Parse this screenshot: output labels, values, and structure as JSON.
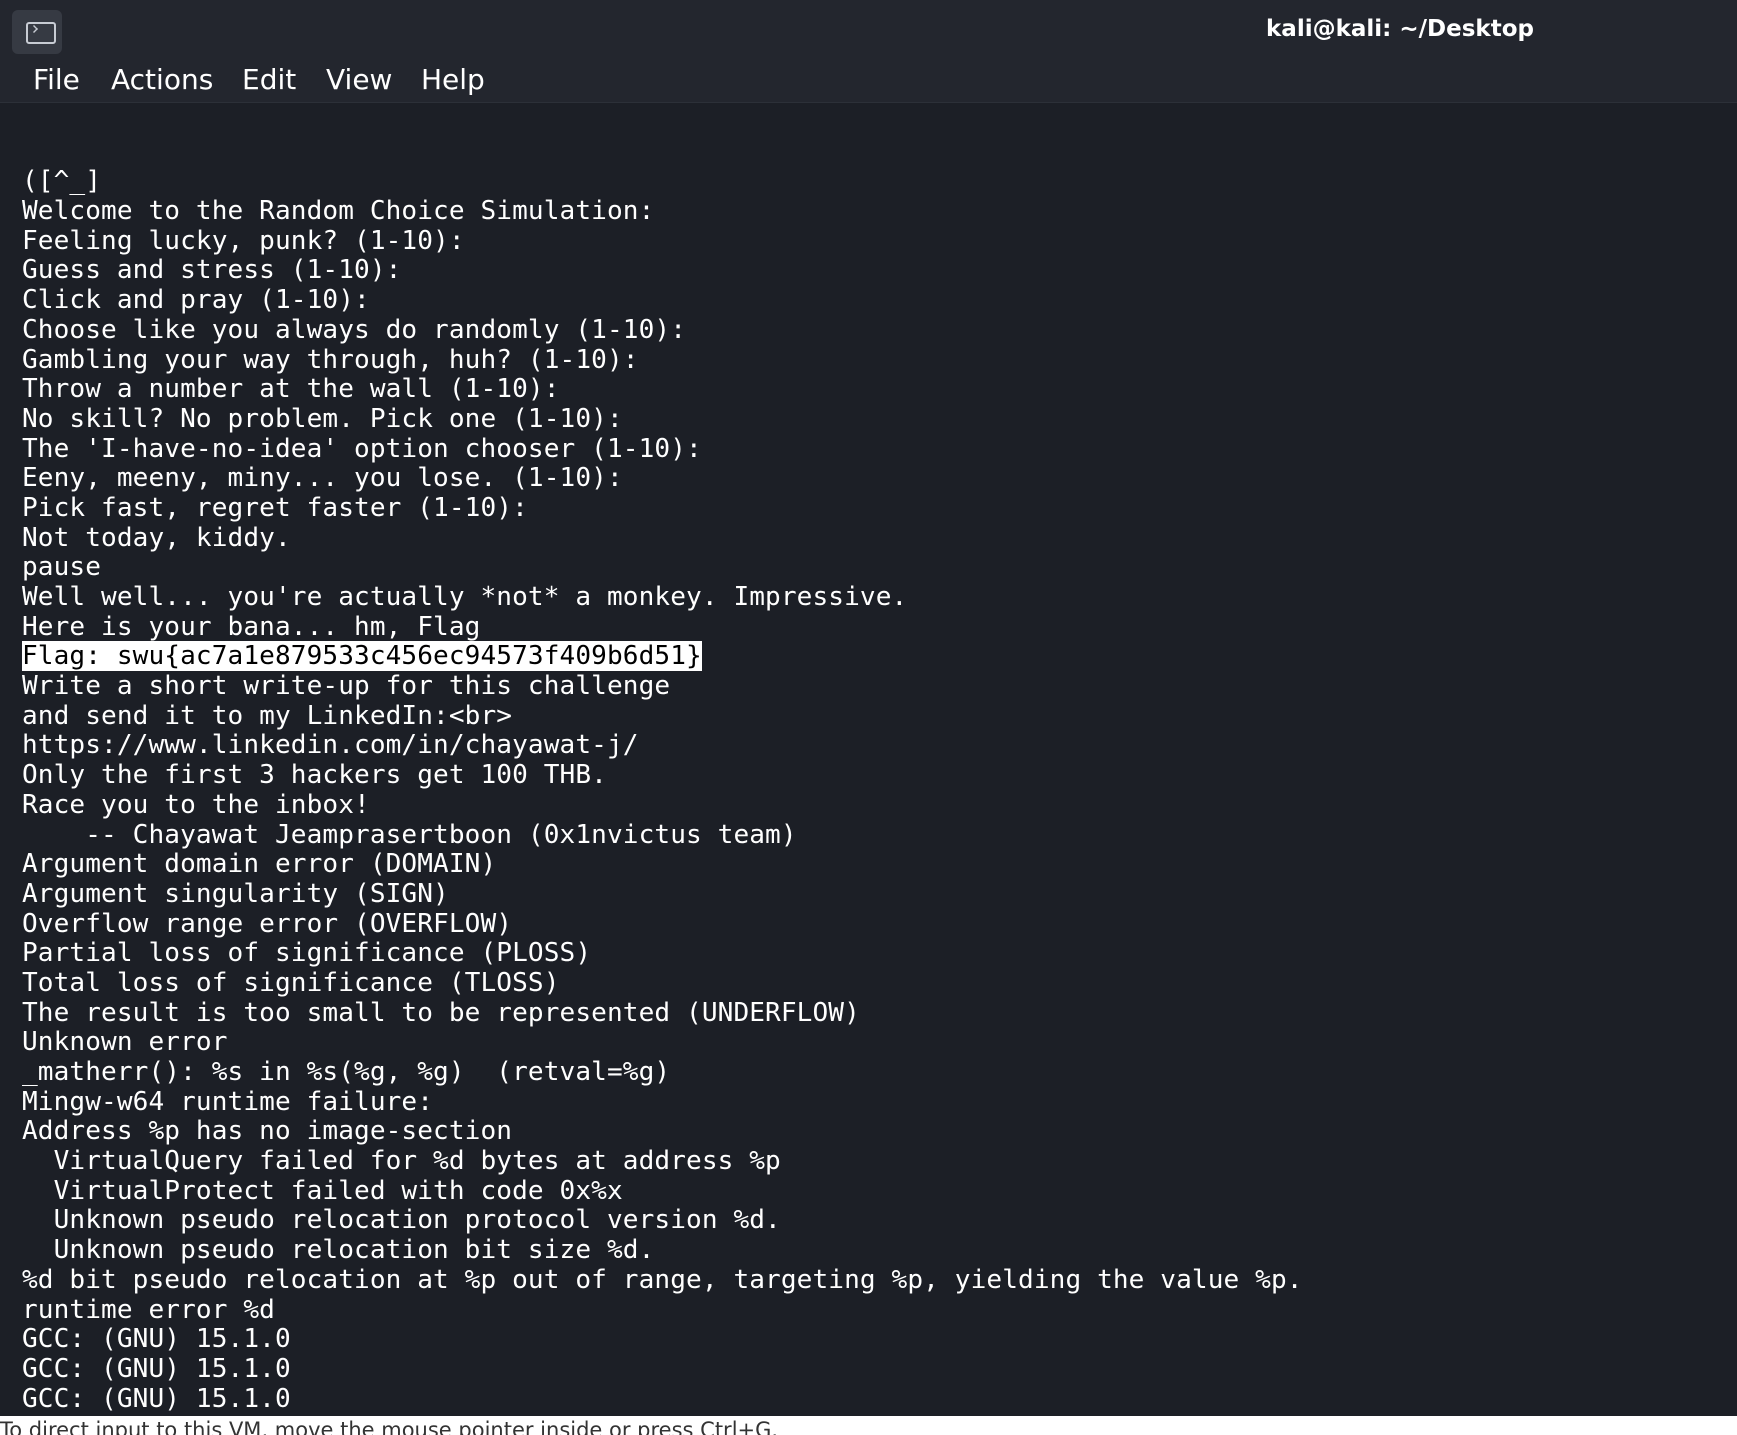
{
  "window": {
    "title": "kali@kali: ~/Desktop",
    "app_icon": "terminal-icon"
  },
  "menu": {
    "items": [
      "File",
      "Actions",
      "Edit",
      "View",
      "Help"
    ]
  },
  "terminal": {
    "lines": [
      "([^_]",
      "Welcome to the Random Choice Simulation:",
      "Feeling lucky, punk? (1-10):",
      "Guess and stress (1-10):",
      "Click and pray (1-10):",
      "Choose like you always do randomly (1-10):",
      "Gambling your way through, huh? (1-10):",
      "Throw a number at the wall (1-10):",
      "No skill? No problem. Pick one (1-10):",
      "The 'I-have-no-idea' option chooser (1-10):",
      "Eeny, meeny, miny... you lose. (1-10):",
      "Pick fast, regret faster (1-10):",
      "Not today, kiddy.",
      "pause",
      "Well well... you're actually *not* a monkey. Impressive.",
      "Here is your bana... hm, Flag",
      "Flag: swu{ac7a1e879533c456ec94573f409b6d51}",
      "Write a short write-up for this challenge",
      "and send it to my LinkedIn:<br>",
      "https://www.linkedin.com/in/chayawat-j/",
      "Only the first 3 hackers get 100 THB.",
      "Race you to the inbox!",
      "    -- Chayawat Jeamprasertboon (0x1nvictus team)",
      "Argument domain error (DOMAIN)",
      "Argument singularity (SIGN)",
      "Overflow range error (OVERFLOW)",
      "Partial loss of significance (PLOSS)",
      "Total loss of significance (TLOSS)",
      "The result is too small to be represented (UNDERFLOW)",
      "Unknown error",
      "_matherr(): %s in %s(%g, %g)  (retval=%g)",
      "Mingw-w64 runtime failure:",
      "Address %p has no image-section",
      "  VirtualQuery failed for %d bytes at address %p",
      "  VirtualProtect failed with code 0x%x",
      "  Unknown pseudo relocation protocol version %d.",
      "  Unknown pseudo relocation bit size %d.",
      "%d bit pseudo relocation at %p out of range, targeting %p, yielding the value %p.",
      "runtime error %d",
      "GCC: (GNU) 15.1.0",
      "GCC: (GNU) 15.1.0",
      "GCC: (GNU) 15.1.0"
    ],
    "highlighted_line_index": 16,
    "prompt": ":"
  },
  "statusbar": {
    "text": "To direct input to this VM, move the mouse pointer inside or press Ctrl+G."
  },
  "colors": {
    "terminal_bg": "#1c1f26",
    "titlebar_bg": "#23262e",
    "text": "#ffffff",
    "highlight_bg": "#ffffff",
    "highlight_text": "#000000"
  }
}
